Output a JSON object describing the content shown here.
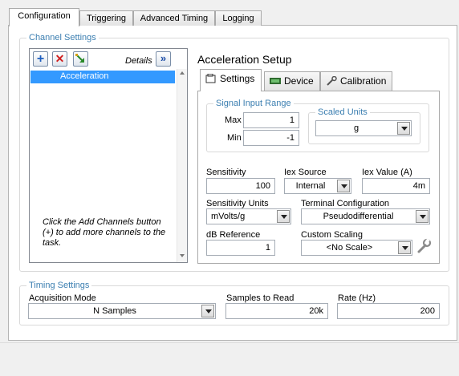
{
  "tabs": [
    {
      "label": "Configuration"
    },
    {
      "label": "Triggering"
    },
    {
      "label": "Advanced Timing"
    },
    {
      "label": "Logging"
    }
  ],
  "channel_settings": {
    "title": "Channel Settings",
    "details_label": "Details",
    "details_icon": "double-chevron-right-icon",
    "channels": [
      "Acceleration"
    ],
    "hint": "Click the Add Channels button (+) to add more channels to the task."
  },
  "setup": {
    "title": "Acceleration Setup",
    "tabs": [
      {
        "label": "Settings",
        "icon": "settings-icon"
      },
      {
        "label": "Device",
        "icon": "device-icon"
      },
      {
        "label": "Calibration",
        "icon": "calibration-icon"
      }
    ],
    "signal_input_range": {
      "title": "Signal Input Range",
      "max_label": "Max",
      "max_value": "1",
      "min_label": "Min",
      "min_value": "-1"
    },
    "scaled_units": {
      "title": "Scaled Units",
      "value": "g"
    },
    "sensitivity": {
      "label": "Sensitivity",
      "value": "100"
    },
    "iex_source": {
      "label": "Iex Source",
      "value": "Internal"
    },
    "iex_value": {
      "label": "Iex Value (A)",
      "value": "4m"
    },
    "sensitivity_units": {
      "label": "Sensitivity Units",
      "value": "mVolts/g"
    },
    "terminal_configuration": {
      "label": "Terminal Configuration",
      "value": "Pseudodifferential"
    },
    "db_reference": {
      "label": "dB Reference",
      "value": "1"
    },
    "custom_scaling": {
      "label": "Custom Scaling",
      "value": "<No Scale>"
    }
  },
  "timing_settings": {
    "title": "Timing Settings",
    "acquisition_mode": {
      "label": "Acquisition Mode",
      "value": "N Samples"
    },
    "samples_to_read": {
      "label": "Samples to Read",
      "value": "20k"
    },
    "rate": {
      "label": "Rate (Hz)",
      "value": "200"
    }
  },
  "colors": {
    "group_title": "#3c7fb1",
    "selection": "#3399ff"
  }
}
